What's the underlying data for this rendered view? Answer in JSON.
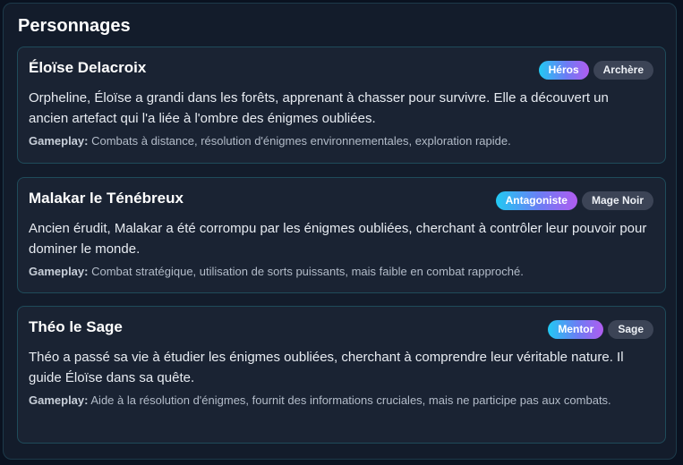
{
  "panel": {
    "title": "Personnages"
  },
  "gameplay_label": "Gameplay:",
  "characters": [
    {
      "name": "Éloïse Delacroix",
      "role": "Héros",
      "class": "Archère",
      "description": "Orpheline, Éloïse a grandi dans les forêts, apprenant à chasser pour survivre. Elle a découvert un ancien artefact qui l'a liée à l'ombre des énigmes oubliées.",
      "gameplay": "Combats à distance, résolution d'énigmes environnementales, exploration rapide."
    },
    {
      "name": "Malakar le Ténébreux",
      "role": "Antagoniste",
      "class": "Mage Noir",
      "description": "Ancien érudit, Malakar a été corrompu par les énigmes oubliées, cherchant à contrôler leur pouvoir pour dominer le monde.",
      "gameplay": "Combat stratégique, utilisation de sorts puissants, mais faible en combat rapproché."
    },
    {
      "name": "Théo le Sage",
      "role": "Mentor",
      "class": "Sage",
      "description": "Théo a passé sa vie à étudier les énigmes oubliées, cherchant à comprendre leur véritable nature. Il guide Éloïse dans sa quête.",
      "gameplay": "Aide à la résolution d'énigmes, fournit des informations cruciales, mais ne participe pas aux combats."
    }
  ],
  "colors": {
    "background": "#0a1220",
    "panel": "#131c2b",
    "card": "#1a2333",
    "card_border": "#1f4b5a",
    "badge_gradient_start": "#22c9f3",
    "badge_gradient_end": "#b05cf0",
    "badge_secondary": "#3c4456"
  }
}
